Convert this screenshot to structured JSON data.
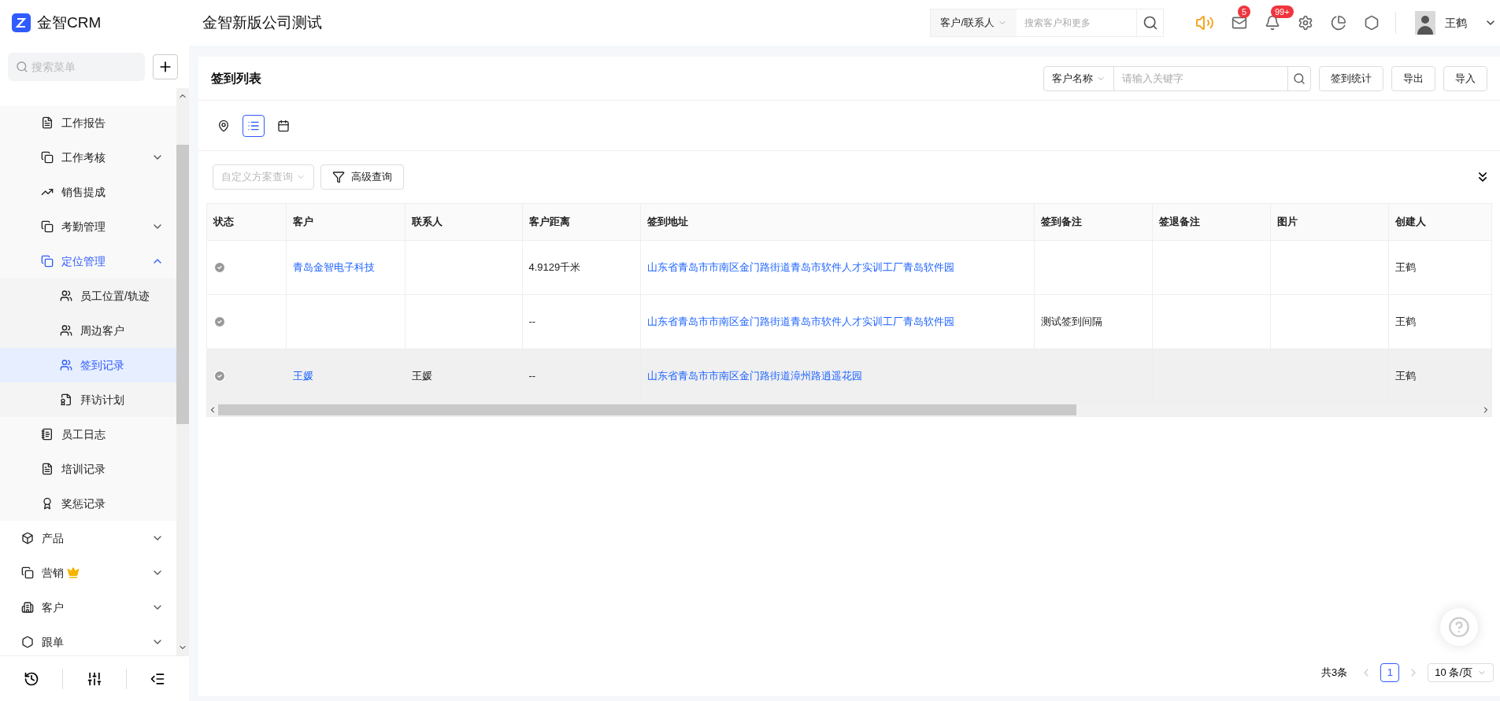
{
  "header": {
    "logo_text": "金智CRM",
    "company": "金智新版公司测试",
    "search_scope": "客户/联系人",
    "search_placeholder": "搜索客户和更多",
    "badges": [
      {
        "count": "5"
      },
      {
        "count": "99+"
      }
    ],
    "user": "王鹤"
  },
  "sidebar": {
    "search_placeholder": "搜索菜单",
    "items": [
      {
        "expanded": true,
        "children": [
          {
            "label": "工作报告",
            "selected": false
          },
          {
            "label": "工作考核",
            "expanded": false,
            "selected": false
          },
          {
            "label": "销售提成",
            "selected": false
          },
          {
            "label": "考勤管理",
            "expanded": false,
            "selected": false
          },
          {
            "label": "定位管理",
            "expanded": true,
            "children": [
              {
                "label": "员工位置/轨迹",
                "selected": false
              },
              {
                "label": "周边客户",
                "selected": false
              },
              {
                "label": "签到记录",
                "selected": true
              },
              {
                "label": "拜访计划",
                "selected": false
              }
            ]
          },
          {
            "label": "员工日志",
            "selected": false
          },
          {
            "label": "培训记录",
            "selected": false
          },
          {
            "label": "奖惩记录",
            "selected": false
          }
        ]
      },
      {
        "label": "产品",
        "expanded": false,
        "selected": false
      },
      {
        "label": "营销",
        "expanded": false,
        "selected": false,
        "premium": true
      },
      {
        "label": "客户",
        "expanded": false,
        "selected": false
      },
      {
        "label": "跟单",
        "expanded": false,
        "selected": false
      }
    ]
  },
  "page": {
    "title": "签到列表",
    "filter_field": "客户名称",
    "keyword_placeholder": "请输入关键字",
    "buttons": [
      "签到统计",
      "导出",
      "导入"
    ],
    "views": [
      {
        "selected": false
      },
      {
        "selected": true
      },
      {
        "selected": false
      }
    ],
    "scheme_placeholder": "自定义方案查询",
    "advanced_search": "高级查询"
  },
  "table": {
    "columns": [
      "状态",
      "客户",
      "联系人",
      "客户距离",
      "签到地址",
      "签到备注",
      "签退备注",
      "图片",
      "创建人"
    ],
    "rows": [
      {
        "selected": false,
        "cells": [
          "",
          "青岛金智电子科技",
          "",
          "4.9129千米",
          "山东省青岛市市南区金门路街道青岛市软件人才实训工厂青岛软件园",
          "",
          "",
          "",
          "王鹤"
        ]
      },
      {
        "selected": false,
        "cells": [
          "",
          "",
          "",
          "--",
          "山东省青岛市市南区金门路街道青岛市软件人才实训工厂青岛软件园",
          "测试签到间隔",
          "",
          "",
          "王鹤"
        ]
      },
      {
        "selected": true,
        "cells": [
          "",
          "王媛",
          "王媛",
          "--",
          "山东省青岛市市南区金门路街道漳州路逍遥花园",
          "",
          "",
          "",
          "王鹤"
        ]
      }
    ]
  },
  "pagination": {
    "total": "共3条",
    "pages": [
      {
        "label": "1",
        "selected": true
      }
    ],
    "page_size": "10 条/页"
  }
}
